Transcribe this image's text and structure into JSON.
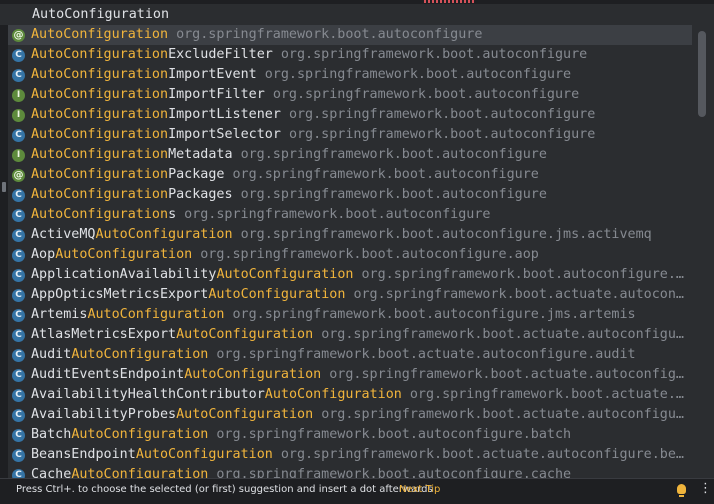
{
  "search": {
    "query": "AutoConfiguration"
  },
  "suggestions": [
    {
      "pre": "",
      "hl": "AutoConfiguration",
      "post": "",
      "pkg": "org.springframework.boot.autoconfigure",
      "icon": "annotation-icon",
      "glyph": "@"
    },
    {
      "pre": "",
      "hl": "AutoConfiguration",
      "post": "ExcludeFilter",
      "pkg": "org.springframework.boot.autoconfigure",
      "icon": "class-icon",
      "glyph": "C"
    },
    {
      "pre": "",
      "hl": "AutoConfiguration",
      "post": "ImportEvent",
      "pkg": "org.springframework.boot.autoconfigure",
      "icon": "class-icon",
      "glyph": "C"
    },
    {
      "pre": "",
      "hl": "AutoConfiguration",
      "post": "ImportFilter",
      "pkg": "org.springframework.boot.autoconfigure",
      "icon": "interface-icon",
      "glyph": "I"
    },
    {
      "pre": "",
      "hl": "AutoConfiguration",
      "post": "ImportListener",
      "pkg": "org.springframework.boot.autoconfigure",
      "icon": "interface-icon",
      "glyph": "I"
    },
    {
      "pre": "",
      "hl": "AutoConfiguration",
      "post": "ImportSelector",
      "pkg": "org.springframework.boot.autoconfigure",
      "icon": "class-icon",
      "glyph": "C"
    },
    {
      "pre": "",
      "hl": "AutoConfiguration",
      "post": "Metadata",
      "pkg": "org.springframework.boot.autoconfigure",
      "icon": "interface-icon",
      "glyph": "I"
    },
    {
      "pre": "",
      "hl": "AutoConfiguration",
      "post": "Package",
      "pkg": "org.springframework.boot.autoconfigure",
      "icon": "annotation-icon",
      "glyph": "@"
    },
    {
      "pre": "",
      "hl": "AutoConfiguration",
      "post": "Packages",
      "pkg": "org.springframework.boot.autoconfigure",
      "icon": "class-icon",
      "glyph": "C"
    },
    {
      "pre": "",
      "hl": "AutoConfiguration",
      "post": "s",
      "pkg": "org.springframework.boot.autoconfigure",
      "icon": "class-icon",
      "glyph": "C"
    },
    {
      "pre": "ActiveMQ",
      "hl": "AutoConfiguration",
      "post": "",
      "pkg": "org.springframework.boot.autoconfigure.jms.activemq",
      "icon": "class-icon",
      "glyph": "C"
    },
    {
      "pre": "Aop",
      "hl": "AutoConfiguration",
      "post": "",
      "pkg": "org.springframework.boot.autoconfigure.aop",
      "icon": "class-icon",
      "glyph": "C"
    },
    {
      "pre": "ApplicationAvailability",
      "hl": "AutoConfiguration",
      "post": "",
      "pkg": "org.springframework.boot.autoconfigure.a…",
      "icon": "class-icon",
      "glyph": "C"
    },
    {
      "pre": "AppOpticsMetricsExport",
      "hl": "AutoConfiguration",
      "post": "",
      "pkg": "org.springframework.boot.actuate.autoconf…",
      "icon": "class-icon",
      "glyph": "C"
    },
    {
      "pre": "Artemis",
      "hl": "AutoConfiguration",
      "post": "",
      "pkg": "org.springframework.boot.autoconfigure.jms.artemis",
      "icon": "class-icon",
      "glyph": "C"
    },
    {
      "pre": "AtlasMetricsExport",
      "hl": "AutoConfiguration",
      "post": "",
      "pkg": "org.springframework.boot.actuate.autoconfigure…",
      "icon": "class-icon",
      "glyph": "C"
    },
    {
      "pre": "Audit",
      "hl": "AutoConfiguration",
      "post": "",
      "pkg": "org.springframework.boot.actuate.autoconfigure.audit",
      "icon": "class-icon",
      "glyph": "C"
    },
    {
      "pre": "AuditEventsEndpoint",
      "hl": "AutoConfiguration",
      "post": "",
      "pkg": "org.springframework.boot.actuate.autoconfigu…",
      "icon": "class-icon",
      "glyph": "C"
    },
    {
      "pre": "AvailabilityHealthContributor",
      "hl": "AutoConfiguration",
      "post": "",
      "pkg": "org.springframework.boot.actuate.a…",
      "icon": "class-icon",
      "glyph": "C"
    },
    {
      "pre": "AvailabilityProbes",
      "hl": "AutoConfiguration",
      "post": "",
      "pkg": "org.springframework.boot.actuate.autoconfigur…",
      "icon": "class-icon",
      "glyph": "C"
    },
    {
      "pre": "Batch",
      "hl": "AutoConfiguration",
      "post": "",
      "pkg": "org.springframework.boot.autoconfigure.batch",
      "icon": "class-icon",
      "glyph": "C"
    },
    {
      "pre": "BeansEndpoint",
      "hl": "AutoConfiguration",
      "post": "",
      "pkg": "org.springframework.boot.actuate.autoconfigure.bea…",
      "icon": "class-icon",
      "glyph": "C"
    },
    {
      "pre": "Cache",
      "hl": "AutoConfiguration",
      "post": "",
      "pkg": "org.springframework.boot.autoconfigure.cache",
      "icon": "class-icon",
      "glyph": "C"
    }
  ],
  "footer": {
    "hint": "Press Ctrl+. to choose the selected (or first) suggestion and insert a dot afterwards",
    "next_tip": "Next Tip",
    "more_glyph": "⋮"
  },
  "colors": {
    "background": "#2b2d30",
    "selected_row": "#3c3f44",
    "match_highlight": "#f0b43c",
    "package_text": "#868a91",
    "class_icon": "#3574a5",
    "interface_icon": "#5d8a3c"
  }
}
